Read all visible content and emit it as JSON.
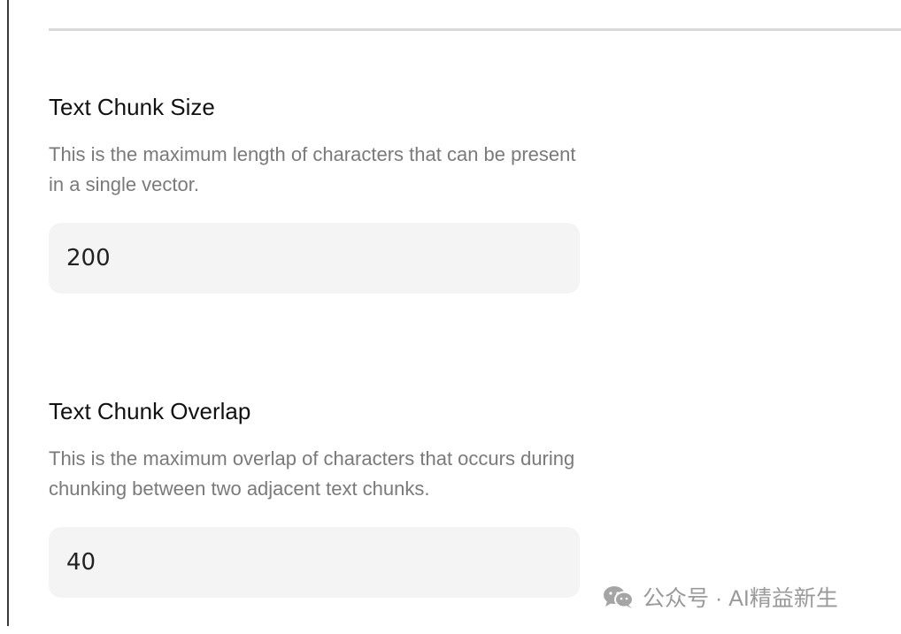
{
  "settings": {
    "chunk_size": {
      "title": "Text Chunk Size",
      "description": "This is the maximum length of characters that can be present in a single vector.",
      "value": "200"
    },
    "chunk_overlap": {
      "title": "Text Chunk Overlap",
      "description": "This is the maximum overlap of characters that occurs during chunking between two adjacent text chunks.",
      "value": "40"
    }
  },
  "watermark": {
    "icon": "wechat-icon",
    "text": "公众号 · AI精益新生"
  },
  "colors": {
    "title_text": "#111111",
    "description_text": "#7a7a7a",
    "input_background": "#f4f4f4",
    "divider": "#d9d9d9",
    "watermark_text": "#9a9a9a"
  }
}
